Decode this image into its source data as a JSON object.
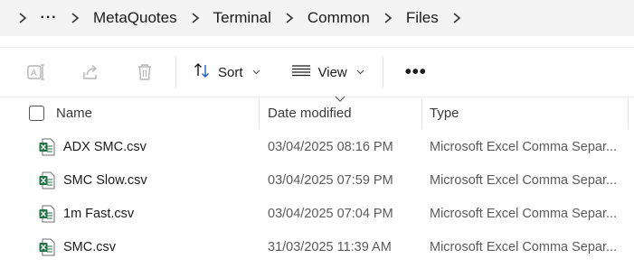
{
  "breadcrumb": {
    "ellipsis": "···",
    "items": [
      "MetaQuotes",
      "Terminal",
      "Common",
      "Files"
    ]
  },
  "toolbar": {
    "rename_icon": "rename-icon",
    "share_icon": "share-icon",
    "delete_icon": "trash-icon",
    "sort_label": "Sort",
    "view_label": "View",
    "more_label": "•••"
  },
  "columns": {
    "name": "Name",
    "date_modified": "Date modified",
    "type": "Type"
  },
  "files": [
    {
      "name": "ADX SMC.csv",
      "date_modified": "03/04/2025 08:16 PM",
      "type": "Microsoft Excel Comma Separ..."
    },
    {
      "name": "SMC Slow.csv",
      "date_modified": "03/04/2025 07:59 PM",
      "type": "Microsoft Excel Comma Separ..."
    },
    {
      "name": "1m Fast.csv",
      "date_modified": "03/04/2025 07:04 PM",
      "type": "Microsoft Excel Comma Separ..."
    },
    {
      "name": "SMC.csv",
      "date_modified": "31/03/2025 11:39 AM",
      "type": "Microsoft Excel Comma Separ..."
    }
  ],
  "colors": {
    "excel_green": "#1f7244",
    "disabled_icon": "#b5b5b5",
    "accent_blue": "#1f5fb8"
  }
}
